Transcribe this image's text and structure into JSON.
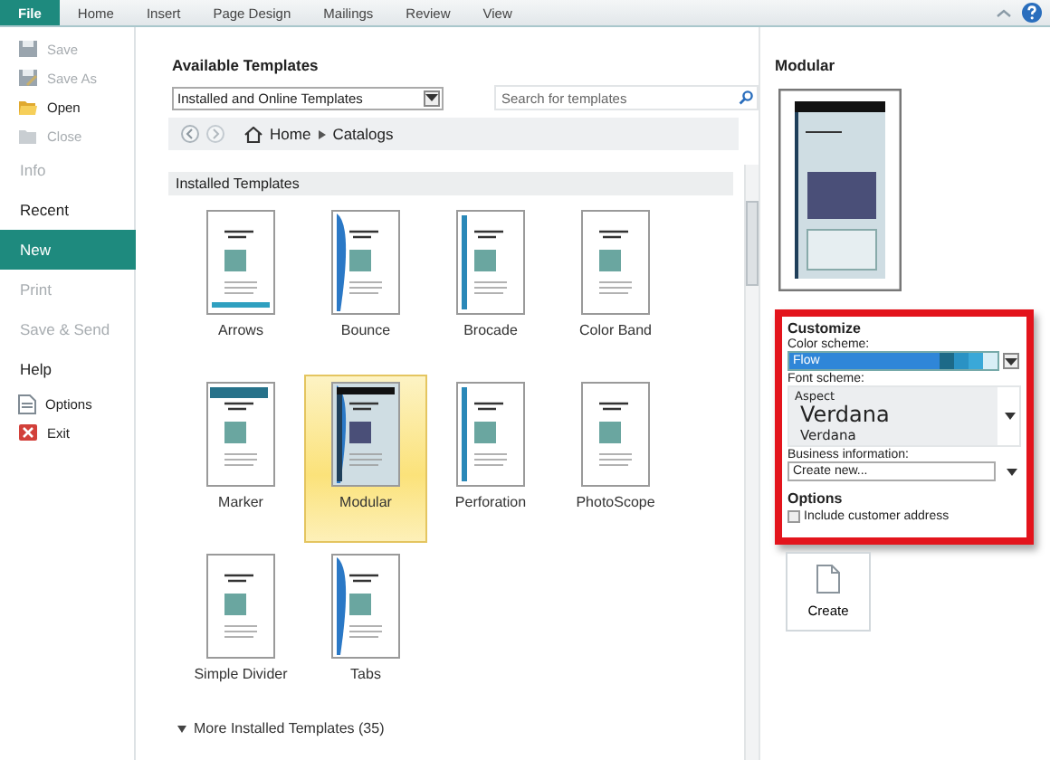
{
  "ribbon": {
    "tabs": [
      {
        "label": "File",
        "selected": true
      },
      {
        "label": "Home",
        "selected": false
      },
      {
        "label": "Insert",
        "selected": false
      },
      {
        "label": "Page Design",
        "selected": false
      },
      {
        "label": "Mailings",
        "selected": false
      },
      {
        "label": "Review",
        "selected": false
      },
      {
        "label": "View",
        "selected": false
      }
    ]
  },
  "sidebar": {
    "items": [
      {
        "kind": "command",
        "label": "Save",
        "disabled": true
      },
      {
        "kind": "command",
        "label": "Save As",
        "disabled": true
      },
      {
        "kind": "command",
        "label": "Open",
        "disabled": false
      },
      {
        "kind": "command",
        "label": "Close",
        "disabled": true
      },
      {
        "kind": "section",
        "label": "Info",
        "disabled": true,
        "selected": false
      },
      {
        "kind": "section",
        "label": "Recent",
        "disabled": false,
        "selected": false
      },
      {
        "kind": "section",
        "label": "New",
        "disabled": false,
        "selected": true
      },
      {
        "kind": "section",
        "label": "Print",
        "disabled": true,
        "selected": false
      },
      {
        "kind": "section",
        "label": "Save & Send",
        "disabled": true,
        "selected": false
      },
      {
        "kind": "section",
        "label": "Help",
        "disabled": false,
        "selected": false
      },
      {
        "kind": "command",
        "label": "Options",
        "disabled": false
      },
      {
        "kind": "command",
        "label": "Exit",
        "disabled": false
      }
    ]
  },
  "main": {
    "title": "Available Templates",
    "source_dropdown": "Installed and Online Templates",
    "search": {
      "placeholder": "Search for templates"
    },
    "breadcrumb": [
      "Home",
      "Catalogs"
    ],
    "section_title": "Installed Templates",
    "templates": [
      {
        "name": "Arrows",
        "selected": false
      },
      {
        "name": "Bounce",
        "selected": false
      },
      {
        "name": "Brocade",
        "selected": false
      },
      {
        "name": "Color Band",
        "selected": false
      },
      {
        "name": "Marker",
        "selected": false
      },
      {
        "name": "Modular",
        "selected": true
      },
      {
        "name": "Perforation",
        "selected": false
      },
      {
        "name": "PhotoScope",
        "selected": false
      },
      {
        "name": "Simple Divider",
        "selected": false
      },
      {
        "name": "Tabs",
        "selected": false
      }
    ],
    "more_link": "More Installed Templates (35)"
  },
  "preview": {
    "title": "Modular",
    "customize": {
      "title": "Customize",
      "color_scheme_label": "Color scheme:",
      "color_scheme": "Flow",
      "font_scheme_label": "Font scheme:",
      "font_scheme": {
        "name": "Aspect",
        "heading": "Verdana",
        "body": "Verdana"
      },
      "business_info_label": "Business information:",
      "business_info": "Create new...",
      "options_title": "Options",
      "include_address": {
        "label": "Include customer address",
        "checked": false
      }
    },
    "create_button": "Create"
  }
}
